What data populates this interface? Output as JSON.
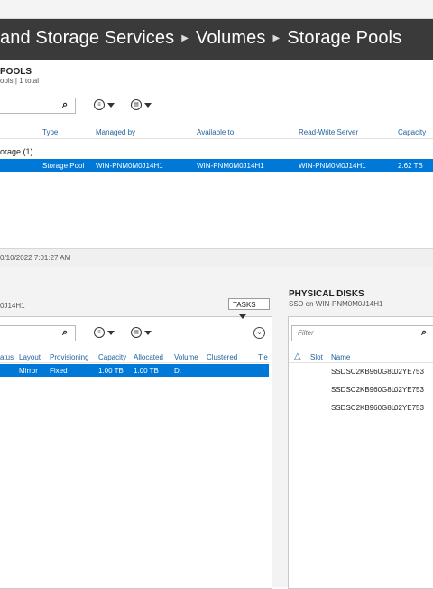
{
  "header": {
    "crumb1": "and Storage Services",
    "crumb2": "Volumes",
    "crumb3": "Storage Pools"
  },
  "storage_pools": {
    "title": "POOLS",
    "subtitle": "ools | 1 total",
    "columns": [
      "Type",
      "Managed by",
      "Available to",
      "Read-Write Server",
      "Capacity"
    ],
    "group_label": "orage (1)",
    "row": {
      "type": "Storage Pool",
      "managed_by": "WIN-PNM0M0J14H1",
      "available_to": "WIN-PNM0M0J14H1",
      "rw_server": "WIN-PNM0M0J14H1",
      "capacity": "2.62 TB"
    }
  },
  "status": {
    "timestamp": "0/10/2022 7:01:27 AM"
  },
  "virtual_disks": {
    "subtitle": "0J14H1",
    "tasks_label": "TASKS",
    "columns": [
      "atus",
      "Layout",
      "Provisioning",
      "Capacity",
      "Allocated",
      "Volume",
      "Clustered",
      "Tie"
    ],
    "row": {
      "status": "",
      "layout": "Mirror",
      "provisioning": "Fixed",
      "capacity": "1.00 TB",
      "allocated": "1.00 TB",
      "volume": "D:",
      "clustered": "",
      "tier": ""
    }
  },
  "physical_disks": {
    "title": "PHYSICAL DISKS",
    "subtitle": "SSD on WIN-PNM0M0J14H1",
    "filter_placeholder": "Filter",
    "columns": [
      "Slot",
      "Name"
    ],
    "rows": [
      {
        "name": "SSDSC2KB960G8L",
        "extra": "02YE753"
      },
      {
        "name": "SSDSC2KB960G8L",
        "extra": "02YE753"
      },
      {
        "name": "SSDSC2KB960G8L",
        "extra": "02YE753"
      }
    ]
  }
}
